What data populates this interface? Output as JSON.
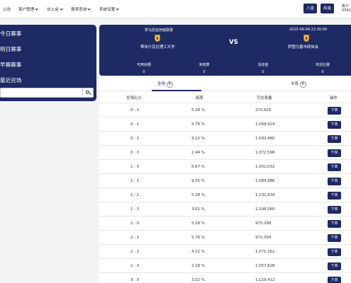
{
  "topnav": {
    "items": [
      {
        "label": "公告",
        "dropdown": false
      },
      {
        "label": "客户管理",
        "dropdown": true
      },
      {
        "label": "出入金",
        "dropdown": true
      },
      {
        "label": "报表查询",
        "dropdown": true
      },
      {
        "label": "系统设置",
        "dropdown": true
      }
    ],
    "deposit_label": "入金",
    "withdraw_label": "出金",
    "account_label": "账户",
    "account_value": "5561"
  },
  "sidebar": {
    "items": [
      {
        "label": "今日赛事"
      },
      {
        "label": "明日赛事"
      },
      {
        "label": "早赛赛事"
      },
      {
        "label": "最近完场"
      }
    ],
    "search": {
      "placeholder": "",
      "value": ""
    }
  },
  "match": {
    "league": "罗马尼亚丙级联赛",
    "datetime": "2025-06-04 22:30:00",
    "home_team": "蒂米什瓦拉理工大学",
    "away_team": "萨图马雷市政体会",
    "vs_label": "VS",
    "stats": [
      {
        "label": "可用余额",
        "value": "0"
      },
      {
        "label": "未结算",
        "value": "0"
      },
      {
        "label": "活动金",
        "value": "0"
      },
      {
        "label": "未完比赛",
        "value": "0"
      }
    ]
  },
  "tabs": [
    {
      "label": "全场",
      "count": "6",
      "active": true
    },
    {
      "label": "半场",
      "count": "6",
      "active": false
    }
  ],
  "table": {
    "headers": [
      "全场比分",
      "赔率",
      "可交易量",
      "操作"
    ],
    "bet_label": "下单",
    "rows": [
      {
        "score": "0 : 0",
        "odds": "5.28 %",
        "volume": "270,826"
      },
      {
        "score": "0 : 1",
        "odds": "5.76 %",
        "volume": "1,068,924"
      },
      {
        "score": "0 : 2",
        "odds": "4.22 %",
        "volume": "1,092,480"
      },
      {
        "score": "0 : 3",
        "odds": "2.44 %",
        "volume": "1,072,598"
      },
      {
        "score": "1 : 0",
        "odds": "6.67 %",
        "volume": "1,001,032"
      },
      {
        "score": "1 : 1",
        "odds": "9.05 %",
        "volume": "1,084,986"
      },
      {
        "score": "1 : 2",
        "odds": "5.28 %",
        "volume": "1,132,834"
      },
      {
        "score": "1 : 3",
        "odds": "3.02 %",
        "volume": "1,106,060"
      },
      {
        "score": "2 : 0",
        "odds": "5.28 %",
        "volume": "975,298"
      },
      {
        "score": "2 : 1",
        "odds": "5.76 %",
        "volume": "972,394"
      },
      {
        "score": "2 : 2",
        "odds": "4.22 %",
        "volume": "1,071,162"
      },
      {
        "score": "2 : 3",
        "odds": "2.18 %",
        "volume": "1,057,628"
      },
      {
        "score": "3 : 0",
        "odds": "3.02 %",
        "volume": "1,119,412"
      }
    ]
  },
  "colors": {
    "primary": "#1e2a64",
    "page_bg": "#f2f3f5",
    "panel_bg": "#ffffff",
    "border": "#e5e5e5"
  }
}
